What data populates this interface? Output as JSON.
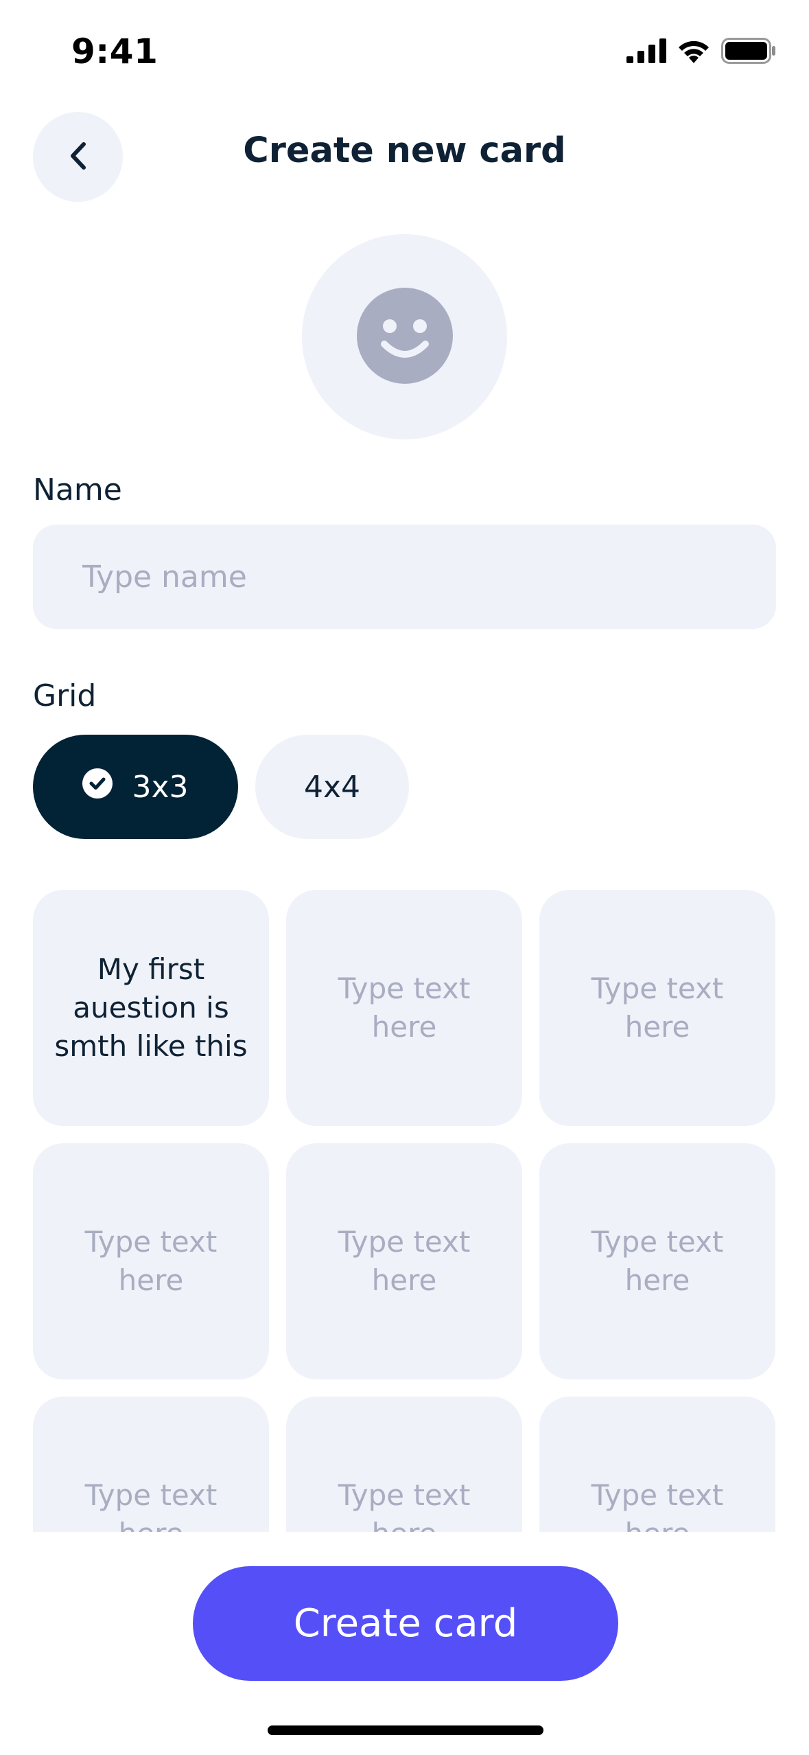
{
  "status_bar": {
    "time": "9:41",
    "icons": [
      "cellular-signal-icon",
      "wifi-icon",
      "battery-icon"
    ]
  },
  "header": {
    "back_icon": "chevron-left-icon",
    "title": "Create new card"
  },
  "avatar": {
    "icon": "smiley-face-icon"
  },
  "name_field": {
    "label": "Name",
    "value": "",
    "placeholder": "Type name"
  },
  "grid_selector": {
    "label": "Grid",
    "options": [
      {
        "label": "3x3",
        "selected": true,
        "icon": "check-circle-icon"
      },
      {
        "label": "4x4",
        "selected": false
      }
    ]
  },
  "cells": [
    {
      "text": "My first auestion is smth like this",
      "filled": true
    },
    {
      "text": "Type text here",
      "filled": false
    },
    {
      "text": "Type text here",
      "filled": false
    },
    {
      "text": "Type text here",
      "filled": false
    },
    {
      "text": "Type text here",
      "filled": false
    },
    {
      "text": "Type text here",
      "filled": false
    },
    {
      "text": "Type text here",
      "filled": false
    },
    {
      "text": "Type text here",
      "filled": false
    },
    {
      "text": "Type text here",
      "filled": false
    }
  ],
  "action": {
    "create_label": "Create card"
  },
  "colors": {
    "primary": "#554ff8",
    "dark": "#022236",
    "surface": "#eff2f9",
    "placeholder": "#a9adc1",
    "icon_gray": "#a9adc1"
  }
}
